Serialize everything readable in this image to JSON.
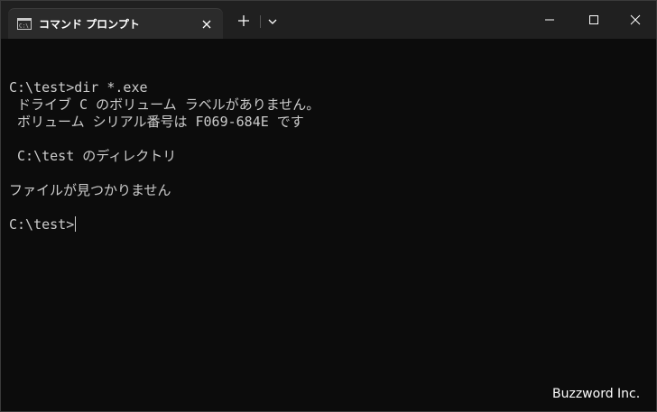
{
  "tab": {
    "title": "コマンド プロンプト",
    "icon": "console-icon"
  },
  "window_controls": {
    "new_tab": "+",
    "dropdown": "chevron-down-icon",
    "minimize": "minimize-icon",
    "maximize": "maximize-icon",
    "close": "close-icon"
  },
  "terminal": {
    "lines": [
      "",
      "C:\\test>dir *.exe",
      " ドライブ C のボリューム ラベルがありません。",
      " ボリューム シリアル番号は F069-684E です",
      "",
      " C:\\test のディレクトリ",
      "",
      "ファイルが見つかりません",
      "",
      "C:\\test>"
    ]
  },
  "watermark": "Buzzword Inc.",
  "colors": {
    "titlebar": "#202020",
    "tab": "#2b2b2b",
    "terminal_bg": "#0c0c0c",
    "terminal_text": "#cccccc"
  }
}
